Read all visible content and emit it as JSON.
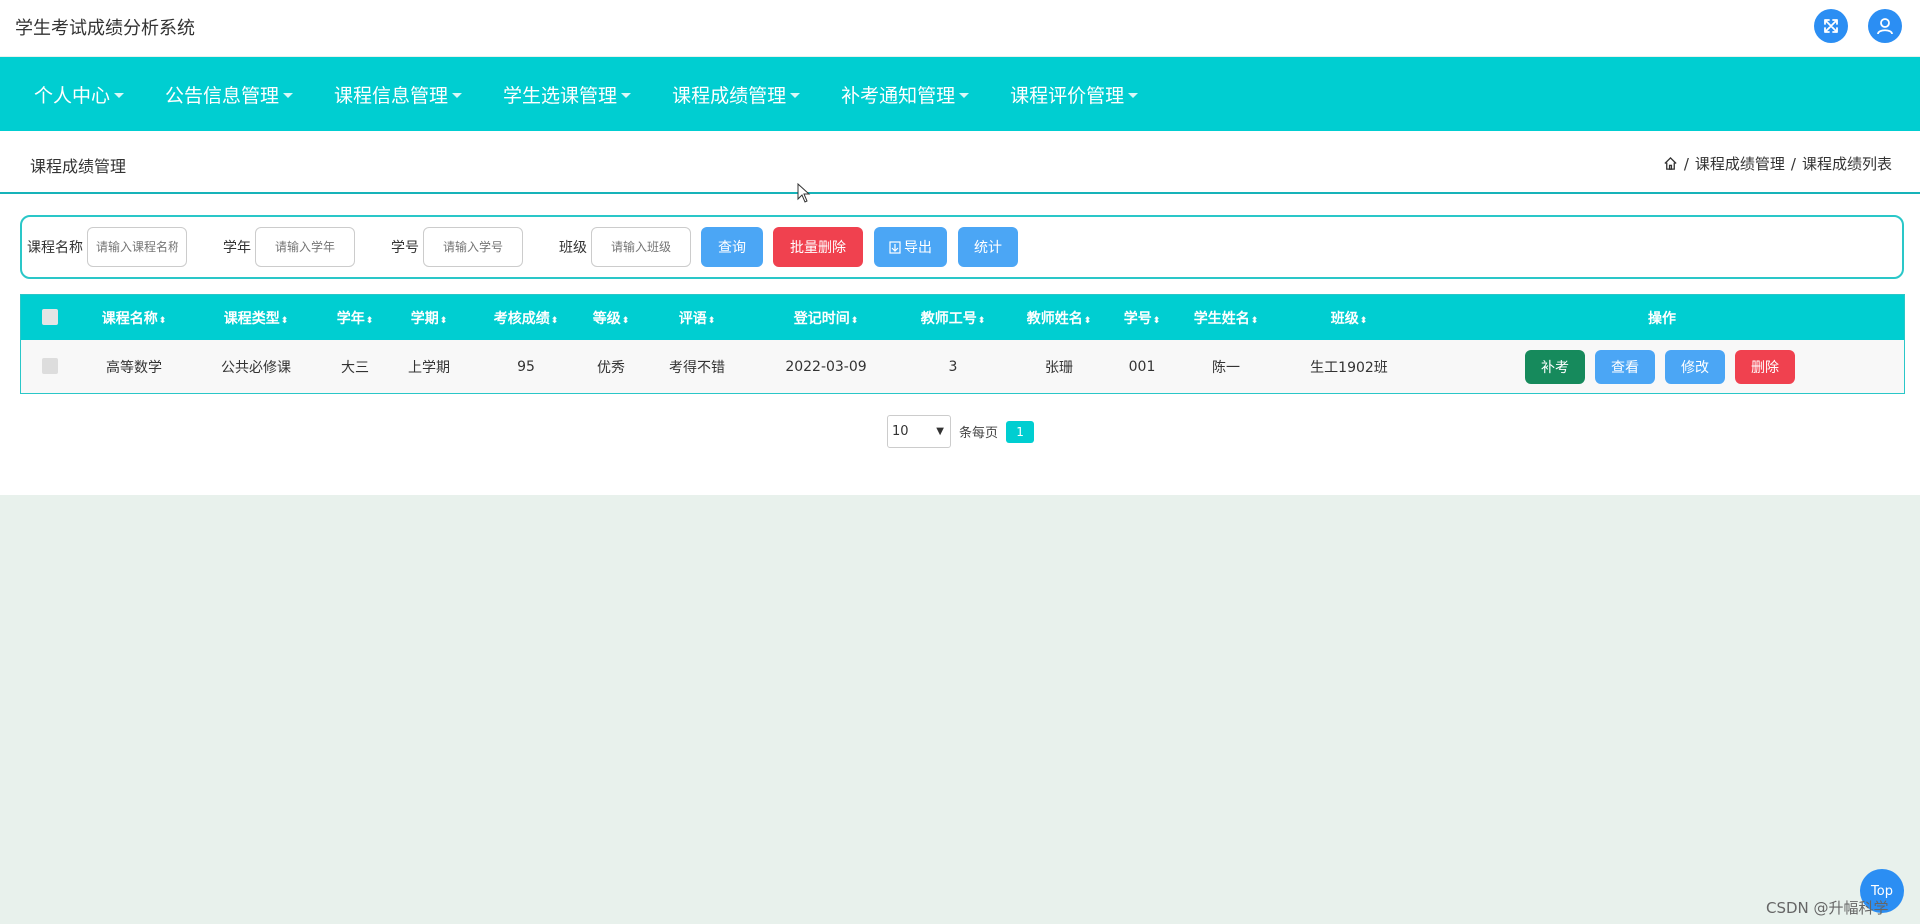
{
  "app": {
    "title": "学生考试成绩分析系统"
  },
  "top_actions": {
    "expand_icon": "expand-arrows-icon",
    "user_icon": "user-icon"
  },
  "nav": {
    "items": [
      {
        "label": "个人中心"
      },
      {
        "label": "公告信息管理"
      },
      {
        "label": "课程信息管理"
      },
      {
        "label": "学生选课管理"
      },
      {
        "label": "课程成绩管理"
      },
      {
        "label": "补考通知管理"
      },
      {
        "label": "课程评价管理"
      }
    ]
  },
  "page": {
    "title": "课程成绩管理",
    "breadcrumb": {
      "sep1": "/",
      "item1": "课程成绩管理",
      "sep2": "/",
      "item2": "课程成绩列表"
    }
  },
  "search": {
    "course_label": "课程名称",
    "course_placeholder": "请输入课程名称",
    "year_label": "学年",
    "year_placeholder": "请输入学年",
    "student_no_label": "学号",
    "student_no_placeholder": "请输入学号",
    "class_label": "班级",
    "class_placeholder": "请输入班级",
    "query_button": "查询",
    "batch_delete_button": "批量删除",
    "export_button": "导出",
    "stats_button": "统计"
  },
  "table": {
    "columns": [
      "课程名称",
      "课程类型",
      "学年",
      "学期",
      "考核成绩",
      "等级",
      "评语",
      "登记时间",
      "教师工号",
      "教师姓名",
      "学号",
      "学生姓名",
      "班级",
      "操作"
    ],
    "rows": [
      {
        "course_name": "高等数学",
        "course_type": "公共必修课",
        "year": "大三",
        "semester": "上学期",
        "score": "95",
        "grade": "优秀",
        "comment": "考得不错",
        "register_time": "2022-03-09",
        "teacher_no": "3",
        "teacher_name": "张珊",
        "student_no": "001",
        "student_name": "陈一",
        "class_name": "生工1902班"
      }
    ],
    "actions": {
      "makeup": "补考",
      "view": "查看",
      "edit": "修改",
      "delete": "删除"
    }
  },
  "pagination": {
    "page_size": "10",
    "per_page_label": "条每页",
    "current_page": "1"
  },
  "footer": {
    "top_button": "Top",
    "watermark": "CSDN @升幅科学"
  },
  "colors": {
    "primary": "#00ced1",
    "blue": "#4ba6f5",
    "red": "#f0414f",
    "green": "#168a5c",
    "background": "#e8f1ec"
  }
}
